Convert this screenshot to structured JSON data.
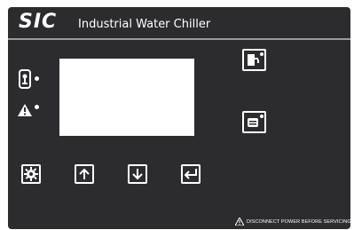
{
  "header": {
    "brand": "SIC",
    "title": "Industrial Water Chiller"
  },
  "display": {
    "text": ""
  },
  "indicators": [
    {
      "name": "Thermometer indicator",
      "icon": "thermometer-icon",
      "lit": true
    },
    {
      "name": "Alarm indicator",
      "icon": "warning-icon",
      "lit": true
    }
  ],
  "keys": [
    {
      "icon": "gear-icon"
    },
    {
      "icon": "arrow-up-icon"
    },
    {
      "icon": "arrow-down-icon"
    },
    {
      "icon": "enter-icon"
    }
  ],
  "function_icons": [
    {
      "icon": "water-tank-icon"
    },
    {
      "icon": "compressor-icon"
    }
  ],
  "footer": {
    "warning": "DISCONNECT POWER BEFORE SERVICING"
  },
  "colors": {
    "panel": "#2c2c2e",
    "foreground": "#ffffff",
    "divider": "#9a9a9a"
  }
}
